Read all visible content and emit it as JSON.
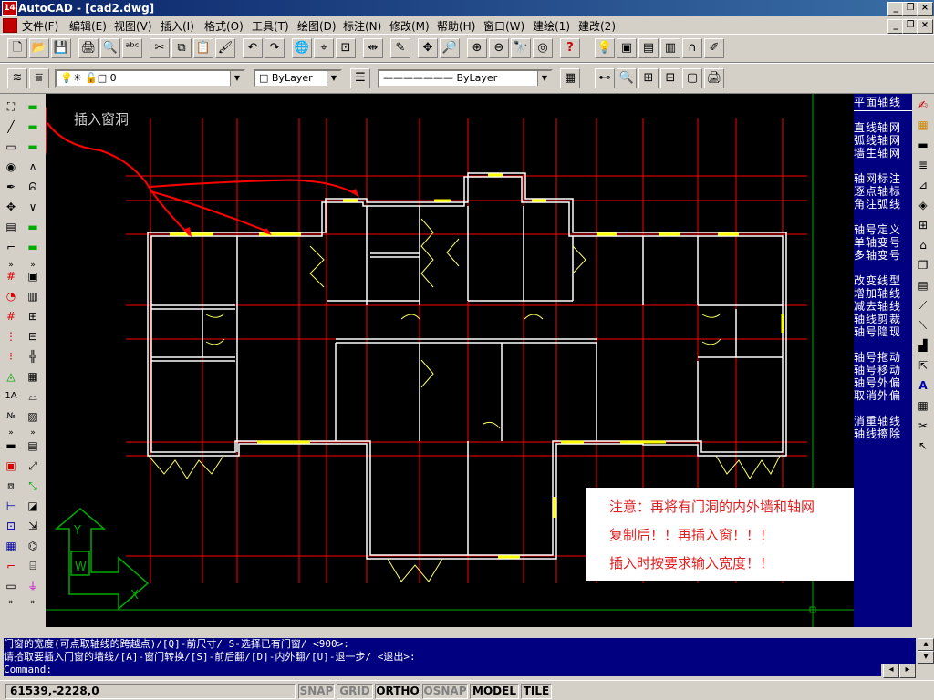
{
  "window": {
    "title": "AutoCAD - [cad2.dwg]",
    "app_icon_label": "14"
  },
  "menu": [
    "文件(F)",
    "编辑(E)",
    "视图(V)",
    "插入(I)",
    "格式(O)",
    "工具(T)",
    "绘图(D)",
    "标注(N)",
    "修改(M)",
    "帮助(H)",
    "窗口(W)",
    "建绘(1)",
    "建改(2)"
  ],
  "layer_toolbar": {
    "layer_value": "0",
    "color_value": "ByLayer",
    "linetype_value": "ByLayer"
  },
  "annotation": {
    "insert_hole_label": "插入窗洞"
  },
  "note": {
    "line1": "注意：再将有门洞的内外墙和轴网",
    "line2": "复制后！！再插入窗！！！",
    "line3": "插入时按要求输入宽度！！"
  },
  "right_menu": {
    "header": "平面轴线",
    "groups": [
      [
        "直线轴网",
        "弧线轴网",
        "墙生轴网"
      ],
      [
        "轴网标注",
        "逐点轴标",
        "角注弧线"
      ],
      [
        "轴号定义",
        "单轴变号",
        "多轴变号"
      ],
      [
        "改变线型",
        "增加轴线",
        "减去轴线",
        "轴线剪裁",
        "轴号隐现"
      ],
      [
        "轴号拖动",
        "轴号移动",
        "轴号外偏",
        "取消外偏"
      ],
      [
        "消重轴线",
        "轴线擦除"
      ]
    ]
  },
  "command": {
    "line1": "门窗的宽度(可点取轴线的跨越点)/[Q]-前尺寸/ S-选择已有门窗/ <900>:",
    "line2": "请拾取要插入门窗的墙线/[A]-窗门转换/[S]-前后翻/[D]-内外翻/[U]-退一步/ <退出>:",
    "line3": "Command:"
  },
  "status": {
    "coords": "61539,-2228,0",
    "snap": "SNAP",
    "grid": "GRID",
    "ortho": "ORTHO",
    "osnap": "OSNAP",
    "model": "MODEL",
    "tile": "TILE"
  },
  "ucs": {
    "x_label": "X",
    "y_label": "Y",
    "w_label": "W"
  },
  "colors": {
    "canvas": "#000000",
    "wall": "#ffffff",
    "axis": "#ff0000",
    "window": "#ffff00",
    "ui_face": "#d4d0c8",
    "menu_bg": "#000080"
  }
}
